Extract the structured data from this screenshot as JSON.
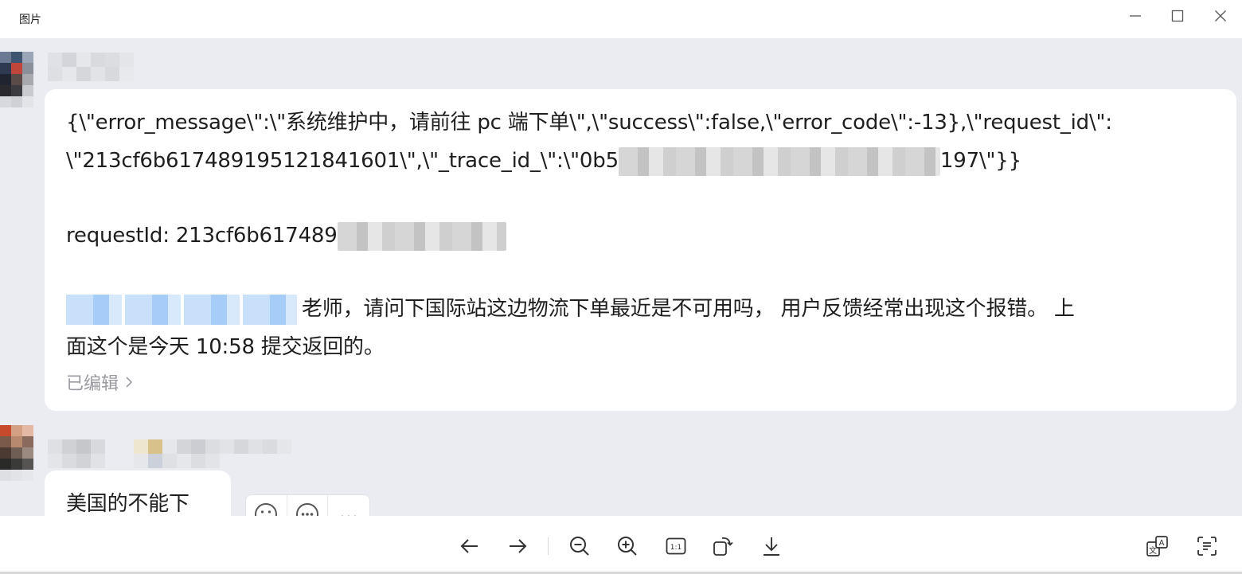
{
  "window": {
    "title": "图片"
  },
  "messages": [
    {
      "lines": [
        "{\\\"error_message\\\":\\\"系统维护中，请前往 pc 端下单\\\",\\\"success\\\":false,\\\"error_code\\\":-13},\\\"request_id\\\":",
        "\\\"213cf6b617489195121841601\\\",\\\"_trace_id_\\\":\\\"0b5",
        "197\\\"}}",
        "requestId: 213cf6b617489",
        "老师，请问下国际站这边物流下单最近是不可用吗， 用户反馈经常出现这个报错。 上",
        "面这个是今天 10:58 提交返回的。"
      ],
      "edited_label": "已编辑"
    },
    {
      "lines": [
        "美国的不能下"
      ]
    }
  ],
  "icons": {
    "reaction_buttons": [
      "emoji-icon",
      "more-reactions-icon",
      "more-icon"
    ],
    "toolbar": [
      "arrow-left-icon",
      "arrow-right-icon",
      "zoom-out-icon",
      "zoom-in-icon",
      "actual-size-icon",
      "rotate-icon",
      "download-icon",
      "translate-icon",
      "scan-text-icon"
    ],
    "window_controls": [
      "minimize-icon",
      "maximize-icon",
      "close-icon"
    ]
  },
  "toolbar": {
    "actual_size_label": "1:1",
    "translate_glyph": "A",
    "translate_glyph2": "文"
  },
  "colors": {
    "content_bg": "#eaecf2",
    "bubble_bg": "#ffffff",
    "edited_text": "#9a9aa0",
    "mention_blue": "#a6ccf8"
  }
}
